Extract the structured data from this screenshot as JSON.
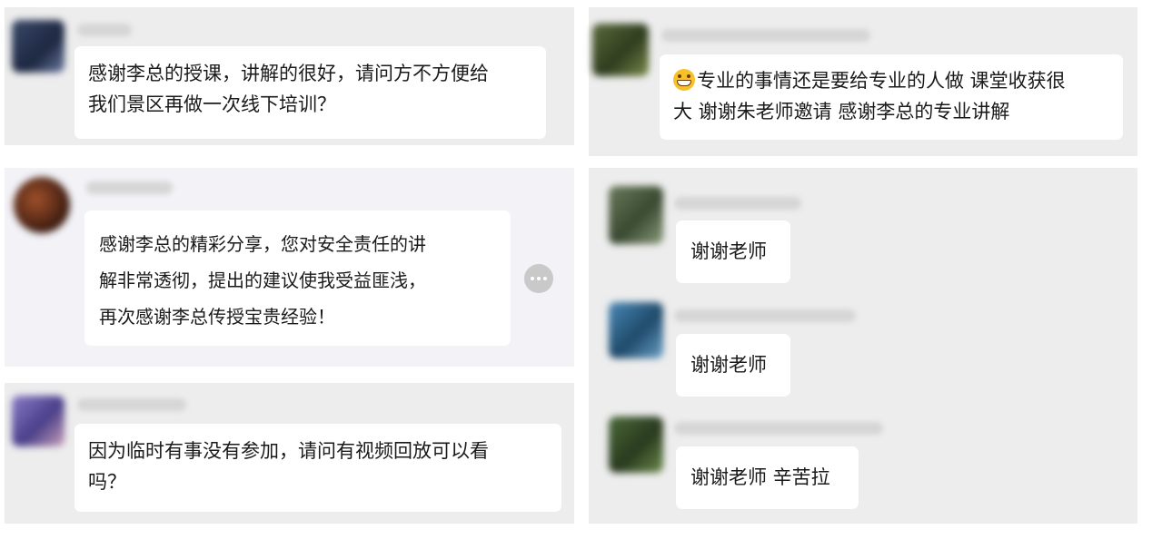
{
  "colors": {
    "panel_bg": "#ededed",
    "panel_highlight_bg": "#f2f2f7",
    "bubble_bg": "#ffffff",
    "more_button": "#c9c9c9"
  },
  "comments_left": [
    {
      "text": "感谢李总的授课，讲解的很好，请问方不方便给\n我们景区再做一次线下培训？",
      "avatar": "blurred-avatar"
    },
    {
      "text": "感谢李总的精彩分享，您对安全责任的讲\n解非常透彻，提出的建议使我受益匪浅，\n再次感谢李总传授宝贵经验！",
      "avatar": "blurred-avatar",
      "has_more_button": true
    },
    {
      "text": "因为临时有事没有参加，请问有视频回放可以看\n吗？",
      "avatar": "blurred-avatar"
    }
  ],
  "comments_right": [
    {
      "emoji": "grinning-face-icon",
      "text": "专业的事情还是要给专业的人做  课堂收获很\n大  谢谢朱老师邀请  感谢李总的专业讲解",
      "avatar": "blurred-avatar"
    },
    {
      "text": "谢谢老师",
      "avatar": "blurred-avatar"
    },
    {
      "text": "谢谢老师",
      "avatar": "blurred-avatar"
    },
    {
      "text": "谢谢老师 辛苦拉",
      "avatar": "blurred-avatar"
    }
  ]
}
